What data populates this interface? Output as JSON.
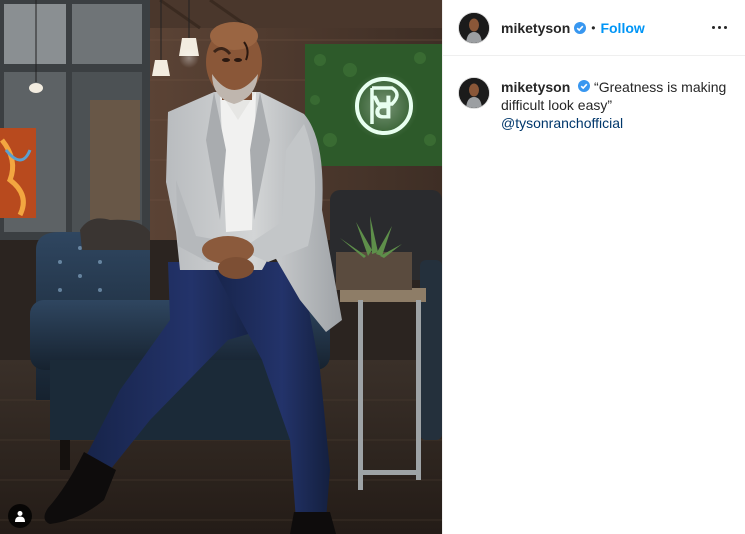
{
  "post": {
    "username": "miketyson",
    "verified": true,
    "separator": "•",
    "follow_label": "Follow",
    "caption_text": "“Greatness is making difficult look easy”",
    "caption_mention": "@tysonranchofficial"
  },
  "colors": {
    "follow": "#0095f6",
    "verified_badge": "#3897f0",
    "mention": "#00376b",
    "neon_logo": "#e8fff0",
    "green_wall": "#2d5a2a"
  },
  "icons": {
    "tag_indicator": "user-tag-icon",
    "more_options": "ellipsis-icon",
    "verified": "verified-badge-icon"
  }
}
